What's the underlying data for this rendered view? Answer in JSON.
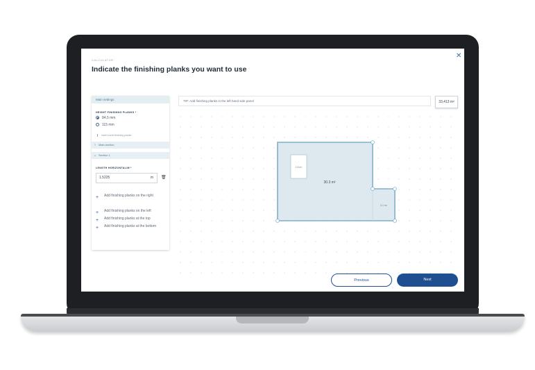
{
  "header": {
    "kicker": "CALCULATOR",
    "title": "Indicate the finishing planks you want to use"
  },
  "panel": {
    "title": "Main settings",
    "height_label": "HEIGHT FINISHING PLANKS *",
    "height_options": [
      "84,5 mm",
      "115 mm"
    ],
    "height_selected": "84,5 mm",
    "insert_note": "Insert cored finishing planks",
    "sections": [
      {
        "label": "Main section",
        "expanded": false
      },
      {
        "label": "Section 1",
        "expanded": true
      }
    ],
    "length_label": "LENGTH HORIZONTAL/M *",
    "length_value": "1.5225",
    "length_unit": "m",
    "add_actions": [
      "Add finishing planks on the right",
      "Add finishing planks on the left",
      "Add finishing planks at the top",
      "Add finishing planks at the bottom"
    ]
  },
  "canvas": {
    "tip": "TIP: Add finishing planks in the left hand side panel",
    "total_area": "33,413 m²",
    "room_main_area": "30.3 m²",
    "small_room_label": "1.8 m²",
    "annex_label": "3.1 m²"
  },
  "footer": {
    "previous_label": "Previous",
    "next_label": "Next"
  },
  "colors": {
    "accent": "#1f4f91",
    "floor_fill": "#dde9ef",
    "floor_stroke": "#7fb0c9"
  }
}
